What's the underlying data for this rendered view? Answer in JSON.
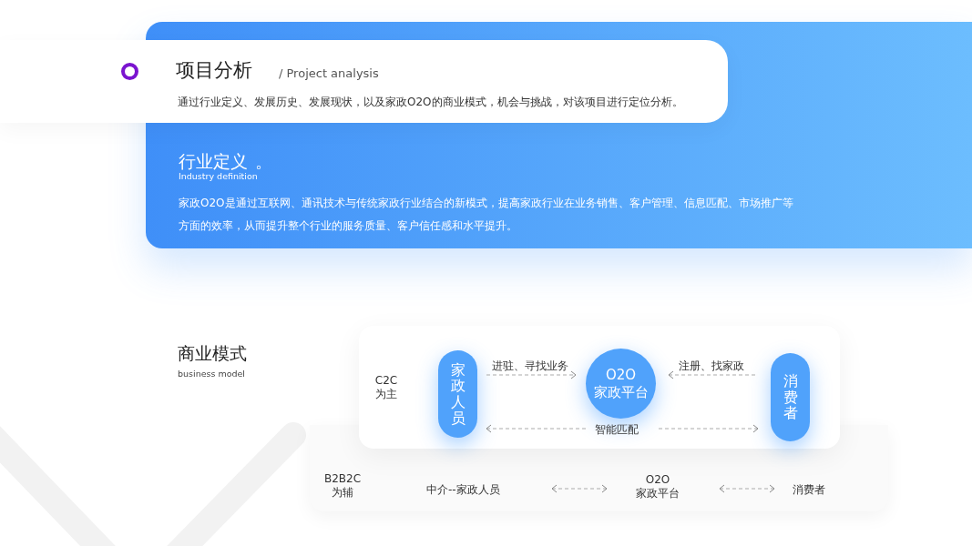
{
  "header": {
    "title": "项目分析",
    "subtitle": "/ Project analysis",
    "description": "通过行业定义、发展历史、发展现状，以及家政O2O的商业模式，机会与挑战，对该项目进行定位分析。"
  },
  "definition": {
    "title": "行业定义",
    "title_mark": "。",
    "subtitle": "Industry definition",
    "text": "家政O2O是通过互联网、通讯技术与传统家政行业结合的新模式，提高家政行业在业务销售、客户管理、信息匹配、市场推广等方面的效率，从而提升整个行业的服务质量、客户信任感和水平提升。"
  },
  "model": {
    "title": "商业模式",
    "subtitle": "business model",
    "primary": {
      "label_lines": [
        "C2C",
        "为主"
      ],
      "nodes": [
        {
          "kind": "pill",
          "lines": [
            "家政人员"
          ]
        },
        {
          "kind": "circle",
          "lines": [
            "O2O",
            "家政平台"
          ]
        },
        {
          "kind": "pill",
          "lines": [
            "消费者"
          ]
        }
      ],
      "links": [
        {
          "text": "进驻、寻找业务",
          "kind": "right"
        },
        {
          "text": "注册、找家政",
          "kind": "left"
        },
        {
          "text": "智能匹配",
          "kind": "both"
        }
      ]
    },
    "secondary": {
      "label_lines": [
        "B2B2C",
        "为辅"
      ],
      "items": [
        {
          "lines": [
            "中介--家政人员"
          ]
        },
        {
          "lines": [
            "O2O",
            "家政平台"
          ]
        },
        {
          "lines": [
            "消费者"
          ]
        }
      ]
    }
  }
}
